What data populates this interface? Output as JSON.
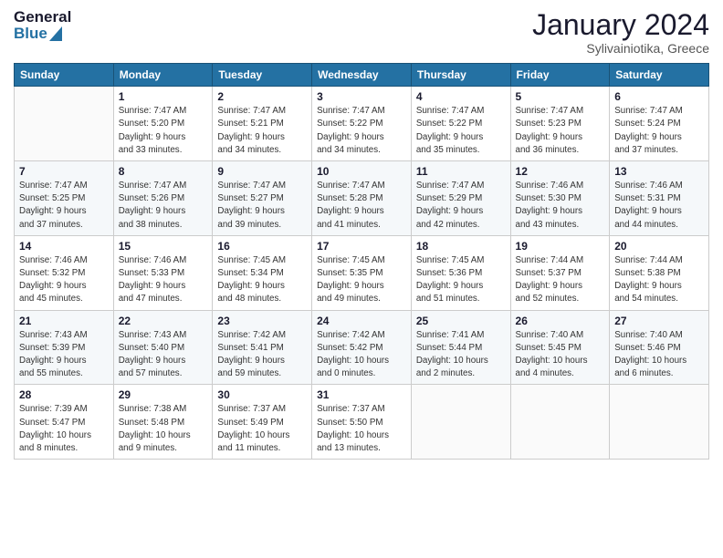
{
  "logo": {
    "general": "General",
    "blue": "Blue"
  },
  "header": {
    "month": "January 2024",
    "location": "Sylivainiotika, Greece"
  },
  "weekdays": [
    "Sunday",
    "Monday",
    "Tuesday",
    "Wednesday",
    "Thursday",
    "Friday",
    "Saturday"
  ],
  "weeks": [
    [
      {
        "day": "",
        "info": ""
      },
      {
        "day": "1",
        "info": "Sunrise: 7:47 AM\nSunset: 5:20 PM\nDaylight: 9 hours\nand 33 minutes."
      },
      {
        "day": "2",
        "info": "Sunrise: 7:47 AM\nSunset: 5:21 PM\nDaylight: 9 hours\nand 34 minutes."
      },
      {
        "day": "3",
        "info": "Sunrise: 7:47 AM\nSunset: 5:22 PM\nDaylight: 9 hours\nand 34 minutes."
      },
      {
        "day": "4",
        "info": "Sunrise: 7:47 AM\nSunset: 5:22 PM\nDaylight: 9 hours\nand 35 minutes."
      },
      {
        "day": "5",
        "info": "Sunrise: 7:47 AM\nSunset: 5:23 PM\nDaylight: 9 hours\nand 36 minutes."
      },
      {
        "day": "6",
        "info": "Sunrise: 7:47 AM\nSunset: 5:24 PM\nDaylight: 9 hours\nand 37 minutes."
      }
    ],
    [
      {
        "day": "7",
        "info": "Sunrise: 7:47 AM\nSunset: 5:25 PM\nDaylight: 9 hours\nand 37 minutes."
      },
      {
        "day": "8",
        "info": "Sunrise: 7:47 AM\nSunset: 5:26 PM\nDaylight: 9 hours\nand 38 minutes."
      },
      {
        "day": "9",
        "info": "Sunrise: 7:47 AM\nSunset: 5:27 PM\nDaylight: 9 hours\nand 39 minutes."
      },
      {
        "day": "10",
        "info": "Sunrise: 7:47 AM\nSunset: 5:28 PM\nDaylight: 9 hours\nand 41 minutes."
      },
      {
        "day": "11",
        "info": "Sunrise: 7:47 AM\nSunset: 5:29 PM\nDaylight: 9 hours\nand 42 minutes."
      },
      {
        "day": "12",
        "info": "Sunrise: 7:46 AM\nSunset: 5:30 PM\nDaylight: 9 hours\nand 43 minutes."
      },
      {
        "day": "13",
        "info": "Sunrise: 7:46 AM\nSunset: 5:31 PM\nDaylight: 9 hours\nand 44 minutes."
      }
    ],
    [
      {
        "day": "14",
        "info": "Sunrise: 7:46 AM\nSunset: 5:32 PM\nDaylight: 9 hours\nand 45 minutes."
      },
      {
        "day": "15",
        "info": "Sunrise: 7:46 AM\nSunset: 5:33 PM\nDaylight: 9 hours\nand 47 minutes."
      },
      {
        "day": "16",
        "info": "Sunrise: 7:45 AM\nSunset: 5:34 PM\nDaylight: 9 hours\nand 48 minutes."
      },
      {
        "day": "17",
        "info": "Sunrise: 7:45 AM\nSunset: 5:35 PM\nDaylight: 9 hours\nand 49 minutes."
      },
      {
        "day": "18",
        "info": "Sunrise: 7:45 AM\nSunset: 5:36 PM\nDaylight: 9 hours\nand 51 minutes."
      },
      {
        "day": "19",
        "info": "Sunrise: 7:44 AM\nSunset: 5:37 PM\nDaylight: 9 hours\nand 52 minutes."
      },
      {
        "day": "20",
        "info": "Sunrise: 7:44 AM\nSunset: 5:38 PM\nDaylight: 9 hours\nand 54 minutes."
      }
    ],
    [
      {
        "day": "21",
        "info": "Sunrise: 7:43 AM\nSunset: 5:39 PM\nDaylight: 9 hours\nand 55 minutes."
      },
      {
        "day": "22",
        "info": "Sunrise: 7:43 AM\nSunset: 5:40 PM\nDaylight: 9 hours\nand 57 minutes."
      },
      {
        "day": "23",
        "info": "Sunrise: 7:42 AM\nSunset: 5:41 PM\nDaylight: 9 hours\nand 59 minutes."
      },
      {
        "day": "24",
        "info": "Sunrise: 7:42 AM\nSunset: 5:42 PM\nDaylight: 10 hours\nand 0 minutes."
      },
      {
        "day": "25",
        "info": "Sunrise: 7:41 AM\nSunset: 5:44 PM\nDaylight: 10 hours\nand 2 minutes."
      },
      {
        "day": "26",
        "info": "Sunrise: 7:40 AM\nSunset: 5:45 PM\nDaylight: 10 hours\nand 4 minutes."
      },
      {
        "day": "27",
        "info": "Sunrise: 7:40 AM\nSunset: 5:46 PM\nDaylight: 10 hours\nand 6 minutes."
      }
    ],
    [
      {
        "day": "28",
        "info": "Sunrise: 7:39 AM\nSunset: 5:47 PM\nDaylight: 10 hours\nand 8 minutes."
      },
      {
        "day": "29",
        "info": "Sunrise: 7:38 AM\nSunset: 5:48 PM\nDaylight: 10 hours\nand 9 minutes."
      },
      {
        "day": "30",
        "info": "Sunrise: 7:37 AM\nSunset: 5:49 PM\nDaylight: 10 hours\nand 11 minutes."
      },
      {
        "day": "31",
        "info": "Sunrise: 7:37 AM\nSunset: 5:50 PM\nDaylight: 10 hours\nand 13 minutes."
      },
      {
        "day": "",
        "info": ""
      },
      {
        "day": "",
        "info": ""
      },
      {
        "day": "",
        "info": ""
      }
    ]
  ]
}
